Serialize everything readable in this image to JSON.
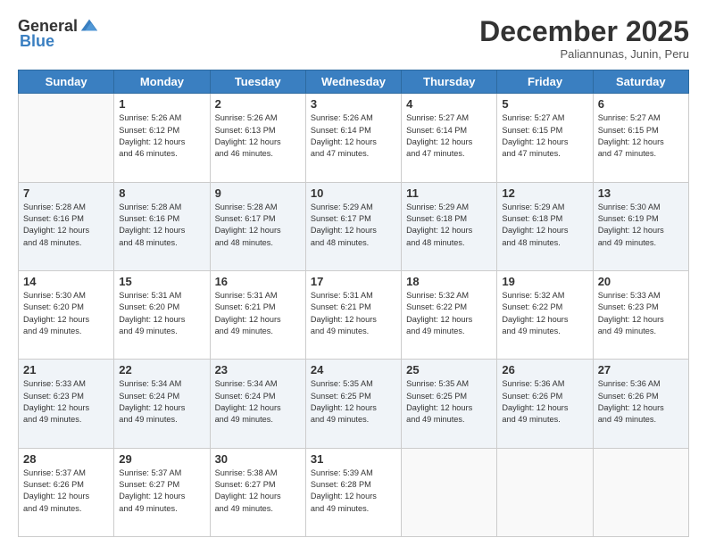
{
  "header": {
    "logo_general": "General",
    "logo_blue": "Blue",
    "title": "December 2025",
    "subtitle": "Paliannunas, Junin, Peru"
  },
  "days_of_week": [
    "Sunday",
    "Monday",
    "Tuesday",
    "Wednesday",
    "Thursday",
    "Friday",
    "Saturday"
  ],
  "weeks": [
    [
      {
        "day": "",
        "sunrise": "",
        "sunset": "",
        "daylight": ""
      },
      {
        "day": "1",
        "sunrise": "Sunrise: 5:26 AM",
        "sunset": "Sunset: 6:12 PM",
        "daylight": "Daylight: 12 hours and 46 minutes."
      },
      {
        "day": "2",
        "sunrise": "Sunrise: 5:26 AM",
        "sunset": "Sunset: 6:13 PM",
        "daylight": "Daylight: 12 hours and 46 minutes."
      },
      {
        "day": "3",
        "sunrise": "Sunrise: 5:26 AM",
        "sunset": "Sunset: 6:14 PM",
        "daylight": "Daylight: 12 hours and 47 minutes."
      },
      {
        "day": "4",
        "sunrise": "Sunrise: 5:27 AM",
        "sunset": "Sunset: 6:14 PM",
        "daylight": "Daylight: 12 hours and 47 minutes."
      },
      {
        "day": "5",
        "sunrise": "Sunrise: 5:27 AM",
        "sunset": "Sunset: 6:15 PM",
        "daylight": "Daylight: 12 hours and 47 minutes."
      },
      {
        "day": "6",
        "sunrise": "Sunrise: 5:27 AM",
        "sunset": "Sunset: 6:15 PM",
        "daylight": "Daylight: 12 hours and 47 minutes."
      }
    ],
    [
      {
        "day": "7",
        "sunrise": "Sunrise: 5:28 AM",
        "sunset": "Sunset: 6:16 PM",
        "daylight": "Daylight: 12 hours and 48 minutes."
      },
      {
        "day": "8",
        "sunrise": "Sunrise: 5:28 AM",
        "sunset": "Sunset: 6:16 PM",
        "daylight": "Daylight: 12 hours and 48 minutes."
      },
      {
        "day": "9",
        "sunrise": "Sunrise: 5:28 AM",
        "sunset": "Sunset: 6:17 PM",
        "daylight": "Daylight: 12 hours and 48 minutes."
      },
      {
        "day": "10",
        "sunrise": "Sunrise: 5:29 AM",
        "sunset": "Sunset: 6:17 PM",
        "daylight": "Daylight: 12 hours and 48 minutes."
      },
      {
        "day": "11",
        "sunrise": "Sunrise: 5:29 AM",
        "sunset": "Sunset: 6:18 PM",
        "daylight": "Daylight: 12 hours and 48 minutes."
      },
      {
        "day": "12",
        "sunrise": "Sunrise: 5:29 AM",
        "sunset": "Sunset: 6:18 PM",
        "daylight": "Daylight: 12 hours and 48 minutes."
      },
      {
        "day": "13",
        "sunrise": "Sunrise: 5:30 AM",
        "sunset": "Sunset: 6:19 PM",
        "daylight": "Daylight: 12 hours and 49 minutes."
      }
    ],
    [
      {
        "day": "14",
        "sunrise": "Sunrise: 5:30 AM",
        "sunset": "Sunset: 6:20 PM",
        "daylight": "Daylight: 12 hours and 49 minutes."
      },
      {
        "day": "15",
        "sunrise": "Sunrise: 5:31 AM",
        "sunset": "Sunset: 6:20 PM",
        "daylight": "Daylight: 12 hours and 49 minutes."
      },
      {
        "day": "16",
        "sunrise": "Sunrise: 5:31 AM",
        "sunset": "Sunset: 6:21 PM",
        "daylight": "Daylight: 12 hours and 49 minutes."
      },
      {
        "day": "17",
        "sunrise": "Sunrise: 5:31 AM",
        "sunset": "Sunset: 6:21 PM",
        "daylight": "Daylight: 12 hours and 49 minutes."
      },
      {
        "day": "18",
        "sunrise": "Sunrise: 5:32 AM",
        "sunset": "Sunset: 6:22 PM",
        "daylight": "Daylight: 12 hours and 49 minutes."
      },
      {
        "day": "19",
        "sunrise": "Sunrise: 5:32 AM",
        "sunset": "Sunset: 6:22 PM",
        "daylight": "Daylight: 12 hours and 49 minutes."
      },
      {
        "day": "20",
        "sunrise": "Sunrise: 5:33 AM",
        "sunset": "Sunset: 6:23 PM",
        "daylight": "Daylight: 12 hours and 49 minutes."
      }
    ],
    [
      {
        "day": "21",
        "sunrise": "Sunrise: 5:33 AM",
        "sunset": "Sunset: 6:23 PM",
        "daylight": "Daylight: 12 hours and 49 minutes."
      },
      {
        "day": "22",
        "sunrise": "Sunrise: 5:34 AM",
        "sunset": "Sunset: 6:24 PM",
        "daylight": "Daylight: 12 hours and 49 minutes."
      },
      {
        "day": "23",
        "sunrise": "Sunrise: 5:34 AM",
        "sunset": "Sunset: 6:24 PM",
        "daylight": "Daylight: 12 hours and 49 minutes."
      },
      {
        "day": "24",
        "sunrise": "Sunrise: 5:35 AM",
        "sunset": "Sunset: 6:25 PM",
        "daylight": "Daylight: 12 hours and 49 minutes."
      },
      {
        "day": "25",
        "sunrise": "Sunrise: 5:35 AM",
        "sunset": "Sunset: 6:25 PM",
        "daylight": "Daylight: 12 hours and 49 minutes."
      },
      {
        "day": "26",
        "sunrise": "Sunrise: 5:36 AM",
        "sunset": "Sunset: 6:26 PM",
        "daylight": "Daylight: 12 hours and 49 minutes."
      },
      {
        "day": "27",
        "sunrise": "Sunrise: 5:36 AM",
        "sunset": "Sunset: 6:26 PM",
        "daylight": "Daylight: 12 hours and 49 minutes."
      }
    ],
    [
      {
        "day": "28",
        "sunrise": "Sunrise: 5:37 AM",
        "sunset": "Sunset: 6:26 PM",
        "daylight": "Daylight: 12 hours and 49 minutes."
      },
      {
        "day": "29",
        "sunrise": "Sunrise: 5:37 AM",
        "sunset": "Sunset: 6:27 PM",
        "daylight": "Daylight: 12 hours and 49 minutes."
      },
      {
        "day": "30",
        "sunrise": "Sunrise: 5:38 AM",
        "sunset": "Sunset: 6:27 PM",
        "daylight": "Daylight: 12 hours and 49 minutes."
      },
      {
        "day": "31",
        "sunrise": "Sunrise: 5:39 AM",
        "sunset": "Sunset: 6:28 PM",
        "daylight": "Daylight: 12 hours and 49 minutes."
      },
      {
        "day": "",
        "sunrise": "",
        "sunset": "",
        "daylight": ""
      },
      {
        "day": "",
        "sunrise": "",
        "sunset": "",
        "daylight": ""
      },
      {
        "day": "",
        "sunrise": "",
        "sunset": "",
        "daylight": ""
      }
    ]
  ]
}
